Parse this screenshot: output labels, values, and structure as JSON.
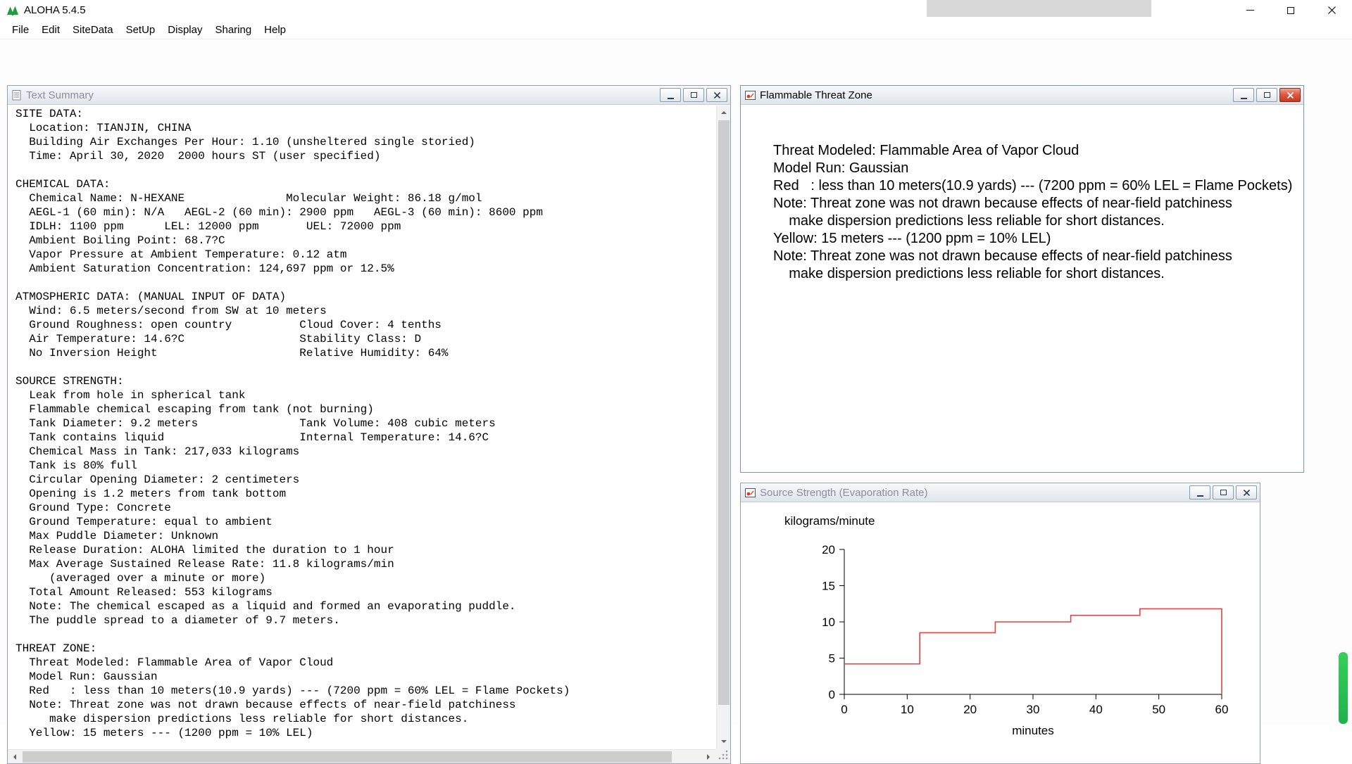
{
  "app": {
    "title": "ALOHA 5.4.5",
    "menu": [
      "File",
      "Edit",
      "SiteData",
      "SetUp",
      "Display",
      "Sharing",
      "Help"
    ]
  },
  "colors": {
    "threat_line_red": "#e04343",
    "active_close_red": "#d94a34",
    "aloha_logo_green": "#1f9d3f",
    "scroll_indicator_green": "#22b14c"
  },
  "icons": {
    "app_logo": "aloha-tree-icon",
    "text_summary": "document-icon",
    "flammable": "threat-chart-icon",
    "source_strength": "threat-chart-icon"
  },
  "windows": {
    "text_summary": {
      "title": "Text Summary",
      "lines": [
        "SITE DATA:",
        "  Location: TIANJIN, CHINA",
        "  Building Air Exchanges Per Hour: 1.10 (unsheltered single storied)",
        "  Time: April 30, 2020  2000 hours ST (user specified)",
        "",
        "CHEMICAL DATA:",
        "  Chemical Name: N-HEXANE               Molecular Weight: 86.18 g/mol",
        "  AEGL-1 (60 min): N/A   AEGL-2 (60 min): 2900 ppm   AEGL-3 (60 min): 8600 ppm",
        "  IDLH: 1100 ppm      LEL: 12000 ppm       UEL: 72000 ppm",
        "  Ambient Boiling Point: 68.7?C",
        "  Vapor Pressure at Ambient Temperature: 0.12 atm",
        "  Ambient Saturation Concentration: 124,697 ppm or 12.5%",
        "",
        "ATMOSPHERIC DATA: (MANUAL INPUT OF DATA)",
        "  Wind: 6.5 meters/second from SW at 10 meters",
        "  Ground Roughness: open country          Cloud Cover: 4 tenths",
        "  Air Temperature: 14.6?C                 Stability Class: D",
        "  No Inversion Height                     Relative Humidity: 64%",
        "",
        "SOURCE STRENGTH:",
        "  Leak from hole in spherical tank",
        "  Flammable chemical escaping from tank (not burning)",
        "  Tank Diameter: 9.2 meters               Tank Volume: 408 cubic meters",
        "  Tank contains liquid                    Internal Temperature: 14.6?C",
        "  Chemical Mass in Tank: 217,033 kilograms",
        "  Tank is 80% full",
        "  Circular Opening Diameter: 2 centimeters",
        "  Opening is 1.2 meters from tank bottom",
        "  Ground Type: Concrete",
        "  Ground Temperature: equal to ambient",
        "  Max Puddle Diameter: Unknown",
        "  Release Duration: ALOHA limited the duration to 1 hour",
        "  Max Average Sustained Release Rate: 11.8 kilograms/min",
        "     (averaged over a minute or more)",
        "  Total Amount Released: 553 kilograms",
        "  Note: The chemical escaped as a liquid and formed an evaporating puddle.",
        "  The puddle spread to a diameter of 9.7 meters.",
        "",
        "THREAT ZONE:",
        "  Threat Modeled: Flammable Area of Vapor Cloud",
        "  Model Run: Gaussian",
        "  Red   : less than 10 meters(10.9 yards) --- (7200 ppm = 60% LEL = Flame Pockets)",
        "  Note: Threat zone was not drawn because effects of near-field patchiness",
        "     make dispersion predictions less reliable for short distances.",
        "  Yellow: 15 meters --- (1200 ppm = 10% LEL)"
      ]
    },
    "flammable": {
      "title": "Flammable Threat Zone",
      "lines": [
        "Threat Modeled: Flammable Area of Vapor Cloud",
        "Model Run: Gaussian",
        "Red   : less than 10 meters(10.9 yards) --- (7200 ppm = 60% LEL = Flame Pockets)",
        "Note: Threat zone was not drawn because effects of near-field patchiness",
        "    make dispersion predictions less reliable for short distances.",
        "Yellow: 15 meters --- (1200 ppm = 10% LEL)",
        "Note: Threat zone was not drawn because effects of near-field patchiness",
        "    make dispersion predictions less reliable for short distances."
      ]
    },
    "source_strength": {
      "title": "Source Strength (Evaporation Rate)",
      "chart_data": {
        "type": "line",
        "subtype": "step",
        "title": "",
        "xlabel": "minutes",
        "ylabel": "kilograms/minute",
        "xlim": [
          0,
          60
        ],
        "ylim": [
          0,
          20
        ],
        "xticks": [
          0,
          10,
          20,
          30,
          40,
          50,
          60
        ],
        "yticks": [
          0,
          5,
          10,
          15,
          20
        ],
        "grid": false,
        "legend": false,
        "line_color": "#e04343",
        "series": [
          {
            "name": "evaporation-rate",
            "points": [
              [
                0,
                4.2
              ],
              [
                12,
                4.2
              ],
              [
                12,
                8.5
              ],
              [
                24,
                8.5
              ],
              [
                24,
                10.0
              ],
              [
                36,
                10.0
              ],
              [
                36,
                10.9
              ],
              [
                47,
                10.9
              ],
              [
                47,
                11.8
              ],
              [
                60,
                11.8
              ],
              [
                60,
                0
              ]
            ]
          }
        ]
      }
    }
  }
}
